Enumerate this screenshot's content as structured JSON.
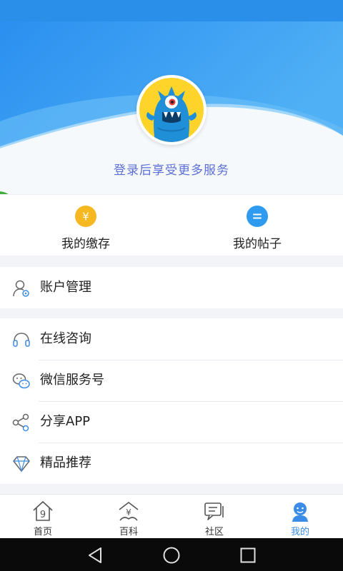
{
  "header": {
    "login_prompt": "登录后享受更多服务"
  },
  "quick_actions": [
    {
      "label": "我的缴存",
      "icon": "yen-coin-icon",
      "color": "#f5b821"
    },
    {
      "label": "我的帖子",
      "icon": "post-bubble-icon",
      "color": "#2e9bf0"
    }
  ],
  "menu": {
    "account": {
      "label": "账户管理",
      "icon": "user-gear-icon"
    },
    "items": [
      {
        "label": "在线咨询",
        "icon": "headset-icon"
      },
      {
        "label": "微信服务号",
        "icon": "wechat-icon"
      },
      {
        "label": "分享APP",
        "icon": "share-icon"
      },
      {
        "label": "精品推荐",
        "icon": "diamond-icon"
      }
    ]
  },
  "tabs": [
    {
      "label": "首页",
      "icon": "home-icon",
      "active": false
    },
    {
      "label": "百科",
      "icon": "encyclopedia-icon",
      "active": false
    },
    {
      "label": "社区",
      "icon": "community-icon",
      "active": false
    },
    {
      "label": "我的",
      "icon": "profile-icon",
      "active": true
    }
  ],
  "colors": {
    "primary": "#2a8fe9",
    "accent_text": "#5b6fd6",
    "active_tab": "#3b8ce6"
  }
}
